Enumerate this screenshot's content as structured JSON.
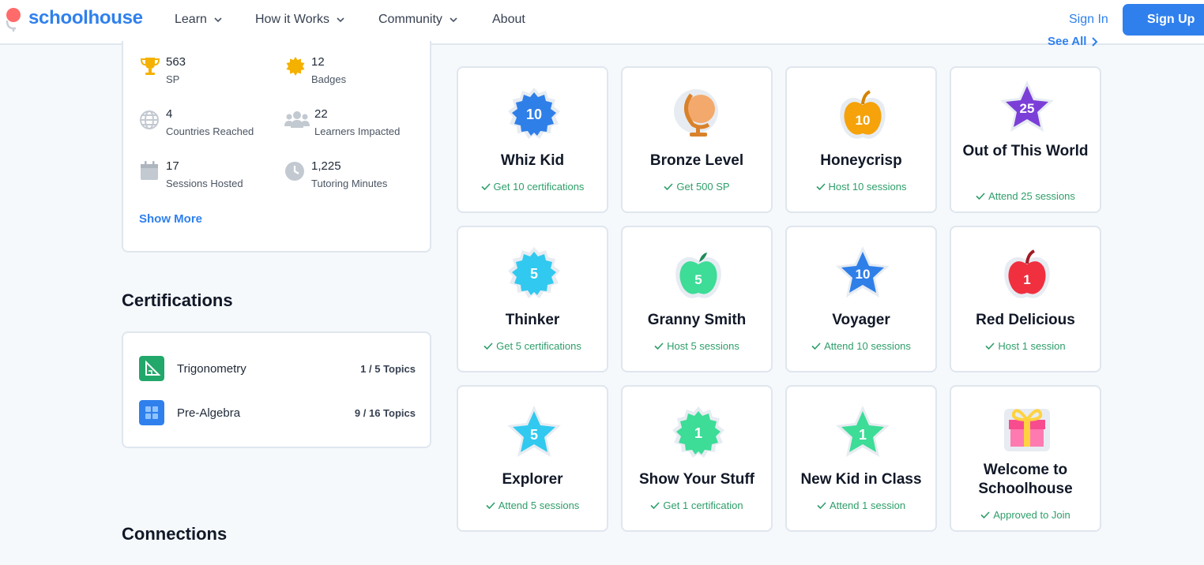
{
  "nav": {
    "brand": "schoolhouse",
    "items": [
      {
        "label": "Learn"
      },
      {
        "label": "How it Works"
      },
      {
        "label": "Community"
      },
      {
        "label": "About"
      }
    ],
    "sign_in": "Sign In",
    "sign_up": "Sign Up"
  },
  "stats": {
    "sp": {
      "value": "563",
      "label": "SP"
    },
    "badges": {
      "value": "12",
      "label": "Badges"
    },
    "countries": {
      "value": "4",
      "label": "Countries Reached"
    },
    "learners": {
      "value": "22",
      "label": "Learners Impacted"
    },
    "sessions": {
      "value": "17",
      "label": "Sessions Hosted"
    },
    "minutes": {
      "value": "1,225",
      "label": "Tutoring Minutes"
    },
    "show_more": "Show More"
  },
  "certifications": {
    "heading": "Certifications",
    "items": [
      {
        "name": "Trigonometry",
        "topics": "1 / 5 Topics"
      },
      {
        "name": "Pre-Algebra",
        "topics": "9 / 16 Topics"
      }
    ]
  },
  "connections": {
    "heading": "Connections"
  },
  "badges_section": {
    "see_all": "See All",
    "items": [
      {
        "name": "Whiz Kid",
        "req": "Get 10 certifications",
        "num": "10",
        "icon": "blue-seal"
      },
      {
        "name": "Bronze Level",
        "req": "Get 500 SP",
        "num": "",
        "icon": "bronze-globe"
      },
      {
        "name": "Honeycrisp",
        "req": "Host 10 sessions",
        "num": "10",
        "icon": "orange-apple"
      },
      {
        "name": "Out of This World",
        "req": "Attend 25 sessions",
        "num": "25",
        "icon": "purple-star"
      },
      {
        "name": "Thinker",
        "req": "Get 5 certifications",
        "num": "5",
        "icon": "cyan-seal"
      },
      {
        "name": "Granny Smith",
        "req": "Host 5 sessions",
        "num": "5",
        "icon": "green-apple"
      },
      {
        "name": "Voyager",
        "req": "Attend 10 sessions",
        "num": "10",
        "icon": "blue-star"
      },
      {
        "name": "Red Delicious",
        "req": "Host 1 session",
        "num": "1",
        "icon": "red-apple"
      },
      {
        "name": "Explorer",
        "req": "Attend 5 sessions",
        "num": "5",
        "icon": "cyan-star"
      },
      {
        "name": "Show Your Stuff",
        "req": "Get 1 certification",
        "num": "1",
        "icon": "green-seal"
      },
      {
        "name": "New Kid in Class",
        "req": "Attend 1 session",
        "num": "1",
        "icon": "green-star"
      },
      {
        "name": "Welcome to Schoolhouse",
        "req": "Approved to Join",
        "num": "",
        "icon": "gift"
      }
    ]
  },
  "colors": {
    "brand": "#2f80ed",
    "success": "#2e9e6a"
  }
}
